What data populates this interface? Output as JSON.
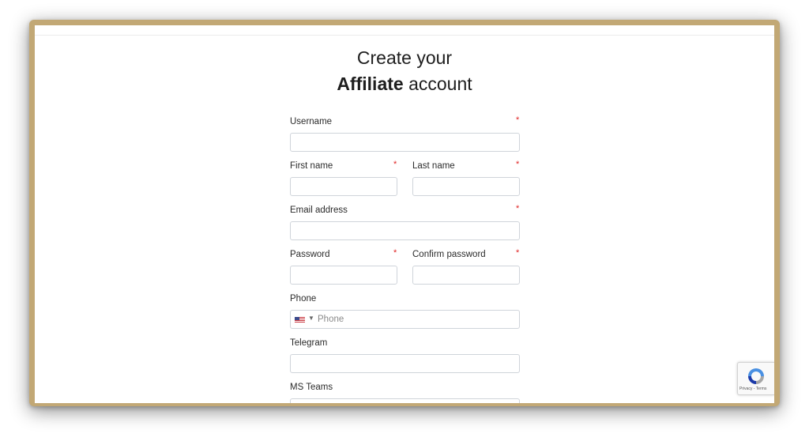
{
  "page": {
    "title_line1": "Create your",
    "title_bold": "Affiliate",
    "title_rest": " account"
  },
  "fields": {
    "username": {
      "label": "Username",
      "required": "*"
    },
    "first_name": {
      "label": "First name",
      "required": "*"
    },
    "last_name": {
      "label": "Last name",
      "required": "*"
    },
    "email": {
      "label": "Email address",
      "required": "*"
    },
    "password": {
      "label": "Password",
      "required": "*"
    },
    "confirm_password": {
      "label": "Confirm password",
      "required": "*"
    },
    "phone": {
      "label": "Phone",
      "placeholder": "Phone",
      "country": "US"
    },
    "telegram": {
      "label": "Telegram"
    },
    "ms_teams": {
      "label": "MS Teams"
    }
  },
  "recaptcha": {
    "text": "Privacy - Terms"
  }
}
